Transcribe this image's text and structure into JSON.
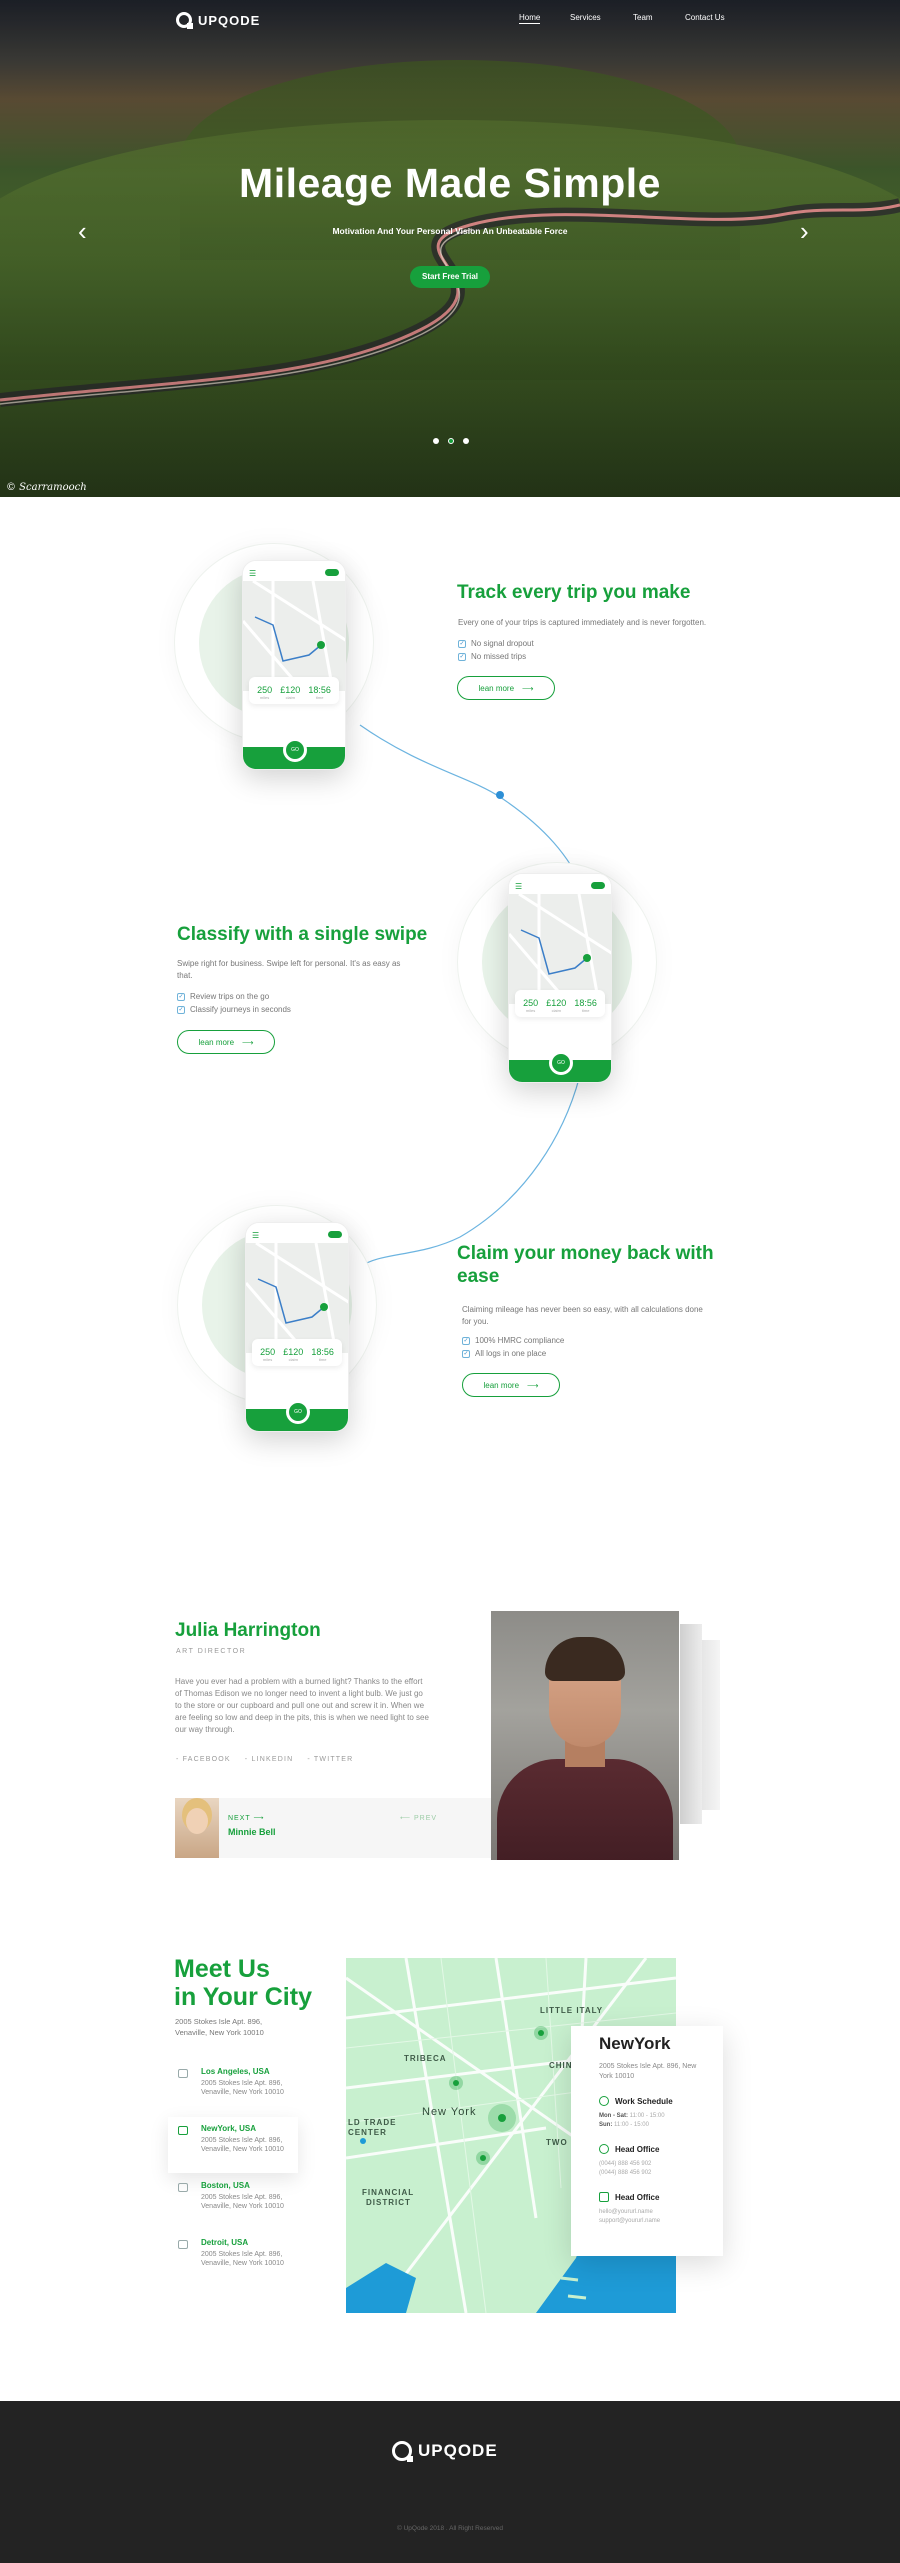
{
  "brand": {
    "name": "UPQODE"
  },
  "nav": {
    "items": [
      "Home",
      "Services",
      "Team",
      "Contact Us"
    ]
  },
  "hero": {
    "title": "Mileage Made Simple",
    "subtitle": "Motivation And Your Personal Vision An Unbeatable Force",
    "cta": "Start Free Trial",
    "credit": "© Scarramooch",
    "slides_total": 3,
    "active_slide": 2,
    "prev_icon": "‹",
    "next_icon": "›"
  },
  "phone": {
    "stat1": "250",
    "stat2": "£120",
    "stat3": "18:56",
    "label1": "miles",
    "label2": "claim",
    "label3": "time",
    "center_btn": "GO"
  },
  "features": [
    {
      "title": "Track every trip you make",
      "desc": "Every one of your trips is captured immediately and is never forgotten.",
      "bullets": [
        "No signal dropout",
        "No missed trips"
      ],
      "button": "lean more"
    },
    {
      "title": "Classify with a single swipe",
      "desc": "Swipe right for business. Swipe left for personal. It's as easy as that.",
      "bullets": [
        "Review trips on the go",
        "Classify journeys in seconds"
      ],
      "button": "lean more"
    },
    {
      "title_line1": "Claim your money back with",
      "title_line2": "ease",
      "desc": "Claiming mileage has never been so easy, with all calculations done for you.",
      "bullets": [
        "100% HMRC compliance",
        "All logs in one place"
      ],
      "button": "lean more"
    }
  ],
  "team": {
    "name": "Julia Harrington",
    "role": "ART DIRECTOR",
    "bio": "Have you ever had a problem with a burned light? Thanks to the effort of Thomas Edison we no longer need to invent a light bulb. We just go to the store or our cupboard and pull one out and screw it in. When we are feeling so low and deep in the pits, this is when we need light to see our way through.",
    "socials": [
      "- FACEBOOK",
      "- LINKEDIN",
      "- TWITTER"
    ],
    "next_label": "NEXT",
    "next_name": "Minnie Bell",
    "prev_label": "PREV"
  },
  "contact": {
    "title_line1": "Meet Us",
    "title_line2": "in Your City",
    "address": "2005 Stokes Isle Apt. 896, Venaville, New York 10010",
    "cities": [
      {
        "name": "Los Angeles, USA",
        "addr": "2005 Stokes Isle Apt. 896, Venaville, New York 10010"
      },
      {
        "name": "NewYork, USA",
        "addr": "2005 Stokes Isle Apt. 896, Venaville, New York 10010"
      },
      {
        "name": "Boston, USA",
        "addr": "2005 Stokes Isle Apt. 896, Venaville, New York 10010"
      },
      {
        "name": "Detroit, USA",
        "addr": "2005 Stokes Isle Apt. 896, Venaville, New York 10010"
      }
    ],
    "map_labels": {
      "little_italy": "LITTLE ITALY",
      "tribeca": "TRIBECA",
      "chin": "CHIN",
      "new_york": "New York",
      "ld_trade": "LD TRADE",
      "center": "CENTER",
      "two": "TWO",
      "financial": "FINANCIAL",
      "district": "DISTRICT"
    },
    "card": {
      "city": "NewYork",
      "address": "2005 Stokes Isle Apt. 896, New York 10010",
      "schedule_title": "Work Schedule",
      "schedule_1_days": "Mon - Sat:",
      "schedule_1_hours": "11:00 - 15:00",
      "schedule_2_days": "Sun:",
      "schedule_2_hours": "11:00 - 15:00",
      "phone_title": "Head Office",
      "phone_1": "(0044) 888 456 902",
      "phone_2": "(0044) 888 456 902",
      "mail_title": "Head Office",
      "mail_1": "hello@yoururl.name",
      "mail_2": "support@yoururl.name"
    }
  },
  "footer": {
    "copyright": "© UpQode 2018 . All Right Reserved"
  },
  "colors": {
    "accent": "#17a03c",
    "footer_bg": "#232323",
    "map_water": "#1e9bd7",
    "map_land": "#c8f0cf"
  }
}
